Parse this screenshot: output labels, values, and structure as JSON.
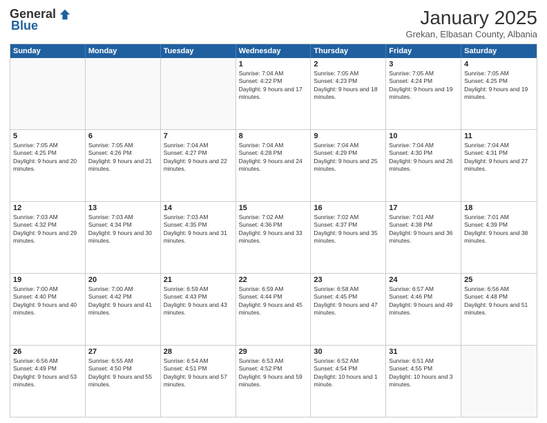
{
  "logo": {
    "general": "General",
    "blue": "Blue"
  },
  "title": "January 2025",
  "subtitle": "Grekan, Elbasan County, Albania",
  "header_days": [
    "Sunday",
    "Monday",
    "Tuesday",
    "Wednesday",
    "Thursday",
    "Friday",
    "Saturday"
  ],
  "rows": [
    [
      {
        "day": "",
        "info": ""
      },
      {
        "day": "",
        "info": ""
      },
      {
        "day": "",
        "info": ""
      },
      {
        "day": "1",
        "info": "Sunrise: 7:04 AM\nSunset: 4:22 PM\nDaylight: 9 hours and 17 minutes."
      },
      {
        "day": "2",
        "info": "Sunrise: 7:05 AM\nSunset: 4:23 PM\nDaylight: 9 hours and 18 minutes."
      },
      {
        "day": "3",
        "info": "Sunrise: 7:05 AM\nSunset: 4:24 PM\nDaylight: 9 hours and 19 minutes."
      },
      {
        "day": "4",
        "info": "Sunrise: 7:05 AM\nSunset: 4:25 PM\nDaylight: 9 hours and 19 minutes."
      }
    ],
    [
      {
        "day": "5",
        "info": "Sunrise: 7:05 AM\nSunset: 4:25 PM\nDaylight: 9 hours and 20 minutes."
      },
      {
        "day": "6",
        "info": "Sunrise: 7:05 AM\nSunset: 4:26 PM\nDaylight: 9 hours and 21 minutes."
      },
      {
        "day": "7",
        "info": "Sunrise: 7:04 AM\nSunset: 4:27 PM\nDaylight: 9 hours and 22 minutes."
      },
      {
        "day": "8",
        "info": "Sunrise: 7:04 AM\nSunset: 4:28 PM\nDaylight: 9 hours and 24 minutes."
      },
      {
        "day": "9",
        "info": "Sunrise: 7:04 AM\nSunset: 4:29 PM\nDaylight: 9 hours and 25 minutes."
      },
      {
        "day": "10",
        "info": "Sunrise: 7:04 AM\nSunset: 4:30 PM\nDaylight: 9 hours and 26 minutes."
      },
      {
        "day": "11",
        "info": "Sunrise: 7:04 AM\nSunset: 4:31 PM\nDaylight: 9 hours and 27 minutes."
      }
    ],
    [
      {
        "day": "12",
        "info": "Sunrise: 7:03 AM\nSunset: 4:32 PM\nDaylight: 9 hours and 29 minutes."
      },
      {
        "day": "13",
        "info": "Sunrise: 7:03 AM\nSunset: 4:34 PM\nDaylight: 9 hours and 30 minutes."
      },
      {
        "day": "14",
        "info": "Sunrise: 7:03 AM\nSunset: 4:35 PM\nDaylight: 9 hours and 31 minutes."
      },
      {
        "day": "15",
        "info": "Sunrise: 7:02 AM\nSunset: 4:36 PM\nDaylight: 9 hours and 33 minutes."
      },
      {
        "day": "16",
        "info": "Sunrise: 7:02 AM\nSunset: 4:37 PM\nDaylight: 9 hours and 35 minutes."
      },
      {
        "day": "17",
        "info": "Sunrise: 7:01 AM\nSunset: 4:38 PM\nDaylight: 9 hours and 36 minutes."
      },
      {
        "day": "18",
        "info": "Sunrise: 7:01 AM\nSunset: 4:39 PM\nDaylight: 9 hours and 38 minutes."
      }
    ],
    [
      {
        "day": "19",
        "info": "Sunrise: 7:00 AM\nSunset: 4:40 PM\nDaylight: 9 hours and 40 minutes."
      },
      {
        "day": "20",
        "info": "Sunrise: 7:00 AM\nSunset: 4:42 PM\nDaylight: 9 hours and 41 minutes."
      },
      {
        "day": "21",
        "info": "Sunrise: 6:59 AM\nSunset: 4:43 PM\nDaylight: 9 hours and 43 minutes."
      },
      {
        "day": "22",
        "info": "Sunrise: 6:59 AM\nSunset: 4:44 PM\nDaylight: 9 hours and 45 minutes."
      },
      {
        "day": "23",
        "info": "Sunrise: 6:58 AM\nSunset: 4:45 PM\nDaylight: 9 hours and 47 minutes."
      },
      {
        "day": "24",
        "info": "Sunrise: 6:57 AM\nSunset: 4:46 PM\nDaylight: 9 hours and 49 minutes."
      },
      {
        "day": "25",
        "info": "Sunrise: 6:56 AM\nSunset: 4:48 PM\nDaylight: 9 hours and 51 minutes."
      }
    ],
    [
      {
        "day": "26",
        "info": "Sunrise: 6:56 AM\nSunset: 4:49 PM\nDaylight: 9 hours and 53 minutes."
      },
      {
        "day": "27",
        "info": "Sunrise: 6:55 AM\nSunset: 4:50 PM\nDaylight: 9 hours and 55 minutes."
      },
      {
        "day": "28",
        "info": "Sunrise: 6:54 AM\nSunset: 4:51 PM\nDaylight: 9 hours and 57 minutes."
      },
      {
        "day": "29",
        "info": "Sunrise: 6:53 AM\nSunset: 4:52 PM\nDaylight: 9 hours and 59 minutes."
      },
      {
        "day": "30",
        "info": "Sunrise: 6:52 AM\nSunset: 4:54 PM\nDaylight: 10 hours and 1 minute."
      },
      {
        "day": "31",
        "info": "Sunrise: 6:51 AM\nSunset: 4:55 PM\nDaylight: 10 hours and 3 minutes."
      },
      {
        "day": "",
        "info": ""
      }
    ]
  ]
}
